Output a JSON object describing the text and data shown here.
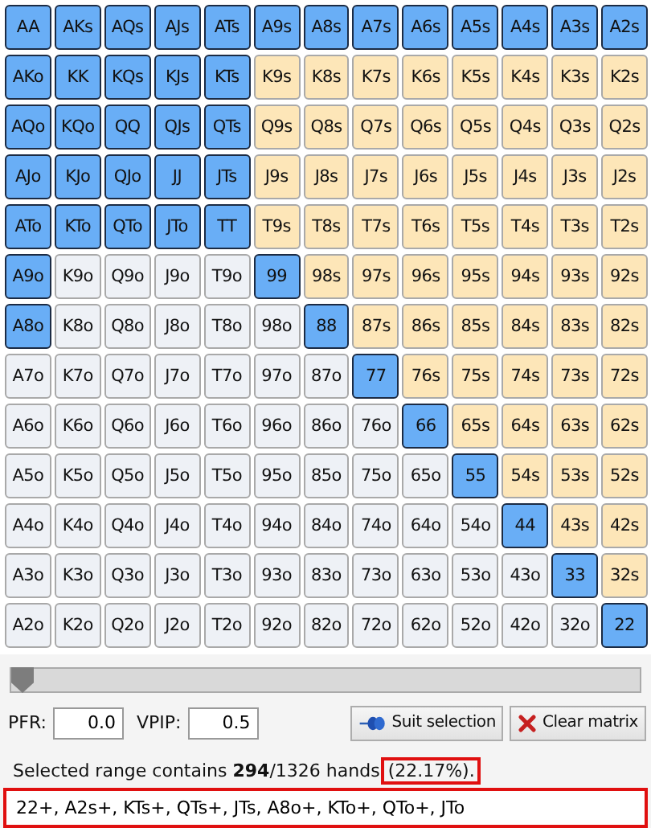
{
  "matrix": {
    "rows": [
      [
        {
          "label": "AA",
          "selected": true
        },
        {
          "label": "AKs",
          "selected": true
        },
        {
          "label": "AQs",
          "selected": true
        },
        {
          "label": "AJs",
          "selected": true
        },
        {
          "label": "ATs",
          "selected": true
        },
        {
          "label": "A9s",
          "selected": true
        },
        {
          "label": "A8s",
          "selected": true
        },
        {
          "label": "A7s",
          "selected": true
        },
        {
          "label": "A6s",
          "selected": true
        },
        {
          "label": "A5s",
          "selected": true
        },
        {
          "label": "A4s",
          "selected": true
        },
        {
          "label": "A3s",
          "selected": true
        },
        {
          "label": "A2s",
          "selected": true
        }
      ],
      [
        {
          "label": "AKo",
          "selected": true
        },
        {
          "label": "KK",
          "selected": true
        },
        {
          "label": "KQs",
          "selected": true
        },
        {
          "label": "KJs",
          "selected": true
        },
        {
          "label": "KTs",
          "selected": true
        },
        {
          "label": "K9s",
          "selected": false
        },
        {
          "label": "K8s",
          "selected": false
        },
        {
          "label": "K7s",
          "selected": false
        },
        {
          "label": "K6s",
          "selected": false
        },
        {
          "label": "K5s",
          "selected": false
        },
        {
          "label": "K4s",
          "selected": false
        },
        {
          "label": "K3s",
          "selected": false
        },
        {
          "label": "K2s",
          "selected": false
        }
      ],
      [
        {
          "label": "AQo",
          "selected": true
        },
        {
          "label": "KQo",
          "selected": true
        },
        {
          "label": "QQ",
          "selected": true
        },
        {
          "label": "QJs",
          "selected": true
        },
        {
          "label": "QTs",
          "selected": true
        },
        {
          "label": "Q9s",
          "selected": false
        },
        {
          "label": "Q8s",
          "selected": false
        },
        {
          "label": "Q7s",
          "selected": false
        },
        {
          "label": "Q6s",
          "selected": false
        },
        {
          "label": "Q5s",
          "selected": false
        },
        {
          "label": "Q4s",
          "selected": false
        },
        {
          "label": "Q3s",
          "selected": false
        },
        {
          "label": "Q2s",
          "selected": false
        }
      ],
      [
        {
          "label": "AJo",
          "selected": true
        },
        {
          "label": "KJo",
          "selected": true
        },
        {
          "label": "QJo",
          "selected": true
        },
        {
          "label": "JJ",
          "selected": true
        },
        {
          "label": "JTs",
          "selected": true
        },
        {
          "label": "J9s",
          "selected": false
        },
        {
          "label": "J8s",
          "selected": false
        },
        {
          "label": "J7s",
          "selected": false
        },
        {
          "label": "J6s",
          "selected": false
        },
        {
          "label": "J5s",
          "selected": false
        },
        {
          "label": "J4s",
          "selected": false
        },
        {
          "label": "J3s",
          "selected": false
        },
        {
          "label": "J2s",
          "selected": false
        }
      ],
      [
        {
          "label": "ATo",
          "selected": true
        },
        {
          "label": "KTo",
          "selected": true
        },
        {
          "label": "QTo",
          "selected": true
        },
        {
          "label": "JTo",
          "selected": true
        },
        {
          "label": "TT",
          "selected": true
        },
        {
          "label": "T9s",
          "selected": false
        },
        {
          "label": "T8s",
          "selected": false
        },
        {
          "label": "T7s",
          "selected": false
        },
        {
          "label": "T6s",
          "selected": false
        },
        {
          "label": "T5s",
          "selected": false
        },
        {
          "label": "T4s",
          "selected": false
        },
        {
          "label": "T3s",
          "selected": false
        },
        {
          "label": "T2s",
          "selected": false
        }
      ],
      [
        {
          "label": "A9o",
          "selected": true
        },
        {
          "label": "K9o",
          "selected": false
        },
        {
          "label": "Q9o",
          "selected": false
        },
        {
          "label": "J9o",
          "selected": false
        },
        {
          "label": "T9o",
          "selected": false
        },
        {
          "label": "99",
          "selected": true
        },
        {
          "label": "98s",
          "selected": false
        },
        {
          "label": "97s",
          "selected": false
        },
        {
          "label": "96s",
          "selected": false
        },
        {
          "label": "95s",
          "selected": false
        },
        {
          "label": "94s",
          "selected": false
        },
        {
          "label": "93s",
          "selected": false
        },
        {
          "label": "92s",
          "selected": false
        }
      ],
      [
        {
          "label": "A8o",
          "selected": true
        },
        {
          "label": "K8o",
          "selected": false
        },
        {
          "label": "Q8o",
          "selected": false
        },
        {
          "label": "J8o",
          "selected": false
        },
        {
          "label": "T8o",
          "selected": false
        },
        {
          "label": "98o",
          "selected": false
        },
        {
          "label": "88",
          "selected": true
        },
        {
          "label": "87s",
          "selected": false
        },
        {
          "label": "86s",
          "selected": false
        },
        {
          "label": "85s",
          "selected": false
        },
        {
          "label": "84s",
          "selected": false
        },
        {
          "label": "83s",
          "selected": false
        },
        {
          "label": "82s",
          "selected": false
        }
      ],
      [
        {
          "label": "A7o",
          "selected": false
        },
        {
          "label": "K7o",
          "selected": false
        },
        {
          "label": "Q7o",
          "selected": false
        },
        {
          "label": "J7o",
          "selected": false
        },
        {
          "label": "T7o",
          "selected": false
        },
        {
          "label": "97o",
          "selected": false
        },
        {
          "label": "87o",
          "selected": false
        },
        {
          "label": "77",
          "selected": true
        },
        {
          "label": "76s",
          "selected": false
        },
        {
          "label": "75s",
          "selected": false
        },
        {
          "label": "74s",
          "selected": false
        },
        {
          "label": "73s",
          "selected": false
        },
        {
          "label": "72s",
          "selected": false
        }
      ],
      [
        {
          "label": "A6o",
          "selected": false
        },
        {
          "label": "K6o",
          "selected": false
        },
        {
          "label": "Q6o",
          "selected": false
        },
        {
          "label": "J6o",
          "selected": false
        },
        {
          "label": "T6o",
          "selected": false
        },
        {
          "label": "96o",
          "selected": false
        },
        {
          "label": "86o",
          "selected": false
        },
        {
          "label": "76o",
          "selected": false
        },
        {
          "label": "66",
          "selected": true
        },
        {
          "label": "65s",
          "selected": false
        },
        {
          "label": "64s",
          "selected": false
        },
        {
          "label": "63s",
          "selected": false
        },
        {
          "label": "62s",
          "selected": false
        }
      ],
      [
        {
          "label": "A5o",
          "selected": false
        },
        {
          "label": "K5o",
          "selected": false
        },
        {
          "label": "Q5o",
          "selected": false
        },
        {
          "label": "J5o",
          "selected": false
        },
        {
          "label": "T5o",
          "selected": false
        },
        {
          "label": "95o",
          "selected": false
        },
        {
          "label": "85o",
          "selected": false
        },
        {
          "label": "75o",
          "selected": false
        },
        {
          "label": "65o",
          "selected": false
        },
        {
          "label": "55",
          "selected": true
        },
        {
          "label": "54s",
          "selected": false
        },
        {
          "label": "53s",
          "selected": false
        },
        {
          "label": "52s",
          "selected": false
        }
      ],
      [
        {
          "label": "A4o",
          "selected": false
        },
        {
          "label": "K4o",
          "selected": false
        },
        {
          "label": "Q4o",
          "selected": false
        },
        {
          "label": "J4o",
          "selected": false
        },
        {
          "label": "T4o",
          "selected": false
        },
        {
          "label": "94o",
          "selected": false
        },
        {
          "label": "84o",
          "selected": false
        },
        {
          "label": "74o",
          "selected": false
        },
        {
          "label": "64o",
          "selected": false
        },
        {
          "label": "54o",
          "selected": false
        },
        {
          "label": "44",
          "selected": true
        },
        {
          "label": "43s",
          "selected": false
        },
        {
          "label": "42s",
          "selected": false
        }
      ],
      [
        {
          "label": "A3o",
          "selected": false
        },
        {
          "label": "K3o",
          "selected": false
        },
        {
          "label": "Q3o",
          "selected": false
        },
        {
          "label": "J3o",
          "selected": false
        },
        {
          "label": "T3o",
          "selected": false
        },
        {
          "label": "93o",
          "selected": false
        },
        {
          "label": "83o",
          "selected": false
        },
        {
          "label": "73o",
          "selected": false
        },
        {
          "label": "63o",
          "selected": false
        },
        {
          "label": "53o",
          "selected": false
        },
        {
          "label": "43o",
          "selected": false
        },
        {
          "label": "33",
          "selected": true
        },
        {
          "label": "32s",
          "selected": false
        }
      ],
      [
        {
          "label": "A2o",
          "selected": false
        },
        {
          "label": "K2o",
          "selected": false
        },
        {
          "label": "Q2o",
          "selected": false
        },
        {
          "label": "J2o",
          "selected": false
        },
        {
          "label": "T2o",
          "selected": false
        },
        {
          "label": "92o",
          "selected": false
        },
        {
          "label": "82o",
          "selected": false
        },
        {
          "label": "72o",
          "selected": false
        },
        {
          "label": "62o",
          "selected": false
        },
        {
          "label": "52o",
          "selected": false
        },
        {
          "label": "42o",
          "selected": false
        },
        {
          "label": "32o",
          "selected": false
        },
        {
          "label": "22",
          "selected": true
        }
      ]
    ]
  },
  "slider": {
    "level": 0
  },
  "pfr": {
    "label": "PFR:",
    "value": "0.0"
  },
  "vpip": {
    "label": "VPIP:",
    "value": "0.5"
  },
  "buttons": [
    {
      "kind": "suit",
      "label": "Suit selection"
    },
    {
      "kind": "clear",
      "label": "Clear matrix"
    }
  ],
  "summary": {
    "text": "Selected range contains **294**/1326 hands",
    "percent": "(22.17%)."
  },
  "range": {
    "value": "22+, A2s+, KTs+, QTs+, JTs, A8o+, KTo+, QTo+, JTo"
  }
}
